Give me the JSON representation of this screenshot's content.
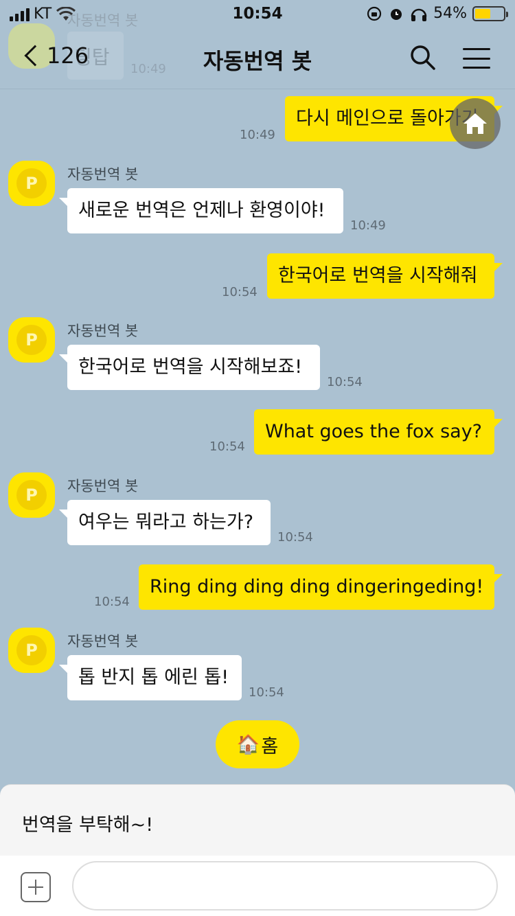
{
  "status": {
    "carrier": "KT",
    "time": "10:54",
    "battery_percent": "54%",
    "battery_level": 0.54,
    "battery_color": "#ffd400"
  },
  "header": {
    "back_count": "126",
    "title": "자동번역 봇",
    "search_icon": "search-icon",
    "menu_icon": "hamburger-menu-icon"
  },
  "ghost": {
    "name": "자동번역 봇",
    "text": "딩탑",
    "time": "10:49"
  },
  "bot_name": "자동번역 봇",
  "messages": [
    {
      "from": "me",
      "text": "다시 메인으로 돌아가기",
      "time": "10:49"
    },
    {
      "from": "bot",
      "text": "새로운 번역은 언제나 환영이야!",
      "time": "10:49"
    },
    {
      "from": "me",
      "text": "한국어로 번역을 시작해줘",
      "time": "10:54"
    },
    {
      "from": "bot",
      "text": "한국어로 번역을 시작해보죠!",
      "time": "10:54"
    },
    {
      "from": "me",
      "text": "What goes the fox say?",
      "time": "10:54"
    },
    {
      "from": "bot",
      "text": "여우는 뭐라고 하는가?",
      "time": "10:54"
    },
    {
      "from": "me",
      "text": "Ring ding ding ding dingeringeding!",
      "time": "10:54"
    },
    {
      "from": "bot",
      "text": "톱 반지 톱 에린 톱!",
      "time": "10:54"
    }
  ],
  "quick_reply": {
    "emoji": "🏠",
    "label": "홈"
  },
  "suggestion": "번역을 부탁해~!",
  "input": {
    "value": "",
    "placeholder": ""
  },
  "colors": {
    "background": "#abc1d1",
    "my_bubble": "#fee500",
    "bot_bubble": "#ffffff"
  }
}
